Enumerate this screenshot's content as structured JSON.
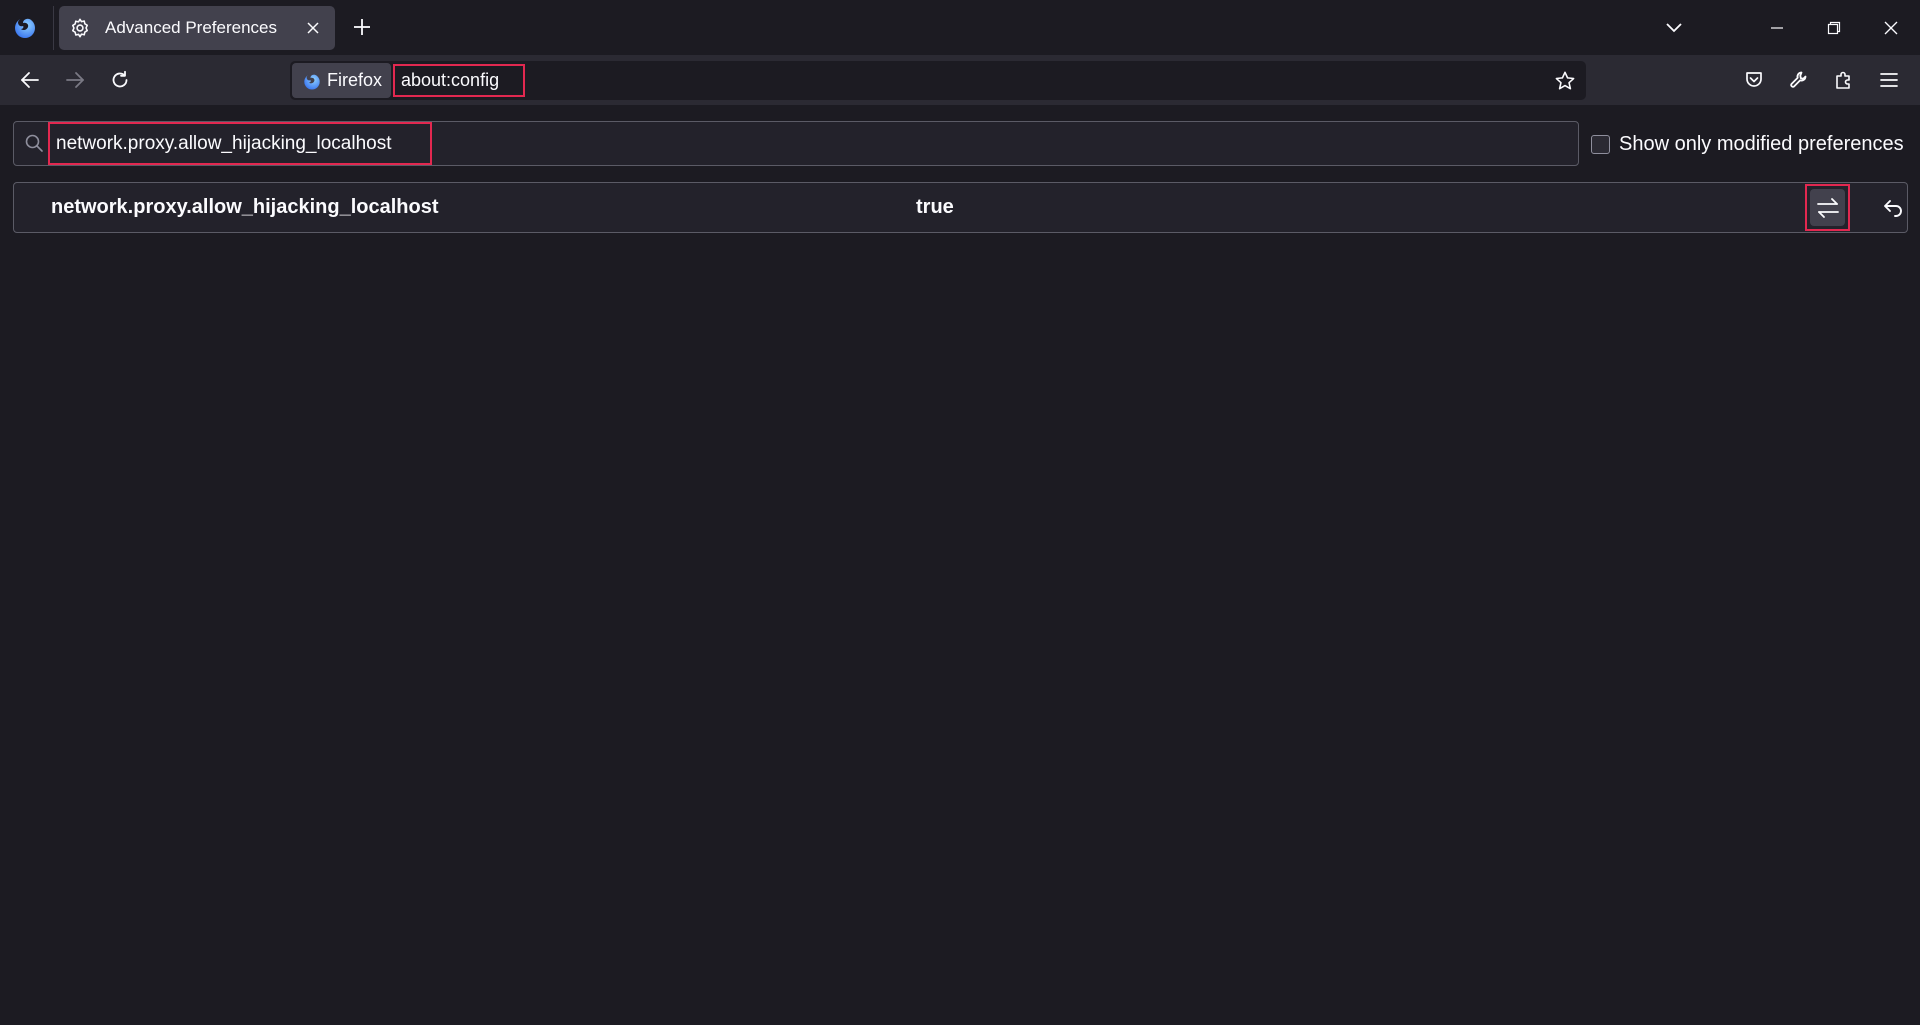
{
  "browser": {
    "tab": {
      "title": "Advanced Preferences",
      "icon": "gear-icon"
    },
    "identity_label": "Firefox",
    "url": "about:config"
  },
  "config": {
    "search": {
      "value": "network.proxy.allow_hijacking_localhost"
    },
    "show_modified_label": "Show only modified preferences",
    "show_modified_checked": false,
    "rows": [
      {
        "name": "network.proxy.allow_hijacking_localhost",
        "value": "true"
      }
    ]
  },
  "colors": {
    "background": "#1c1b22",
    "toolbar": "#2b2a33",
    "tab_selected": "#42414d",
    "highlight_box": "#e22850",
    "text": "#fbfbfe"
  }
}
